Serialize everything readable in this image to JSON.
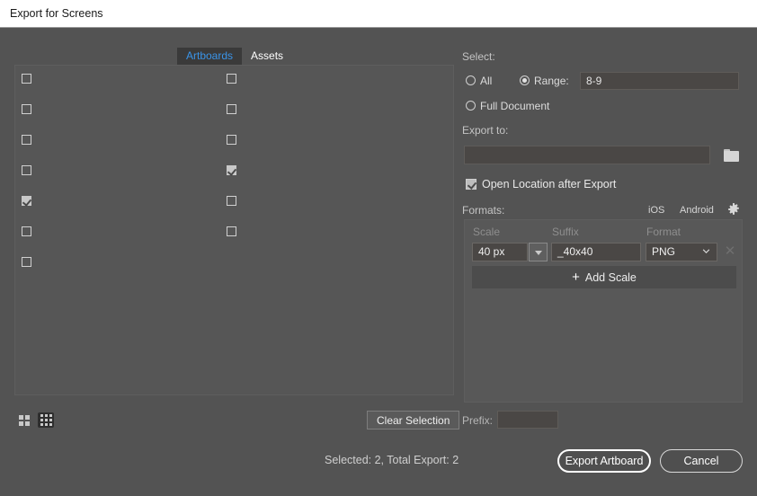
{
  "window": {
    "title": "Export for Screens"
  },
  "tabs": [
    {
      "label": "Artboards",
      "active": true
    },
    {
      "label": "Assets",
      "active": false
    }
  ],
  "artboard_list": {
    "left_column": [
      {
        "checked": false
      },
      {
        "checked": false
      },
      {
        "checked": false
      },
      {
        "checked": false
      },
      {
        "checked": true
      },
      {
        "checked": false
      },
      {
        "checked": false
      }
    ],
    "right_column": [
      {
        "checked": false
      },
      {
        "checked": false
      },
      {
        "checked": false
      },
      {
        "checked": true
      },
      {
        "checked": false
      },
      {
        "checked": false
      }
    ]
  },
  "view_toggles": [
    {
      "icon": "grid-view-icon",
      "selected": false
    },
    {
      "icon": "detail-view-icon",
      "selected": true
    }
  ],
  "left_footer": {
    "clear_selection_label": "Clear Selection"
  },
  "select": {
    "heading": "Select:",
    "options": [
      {
        "label": "All",
        "selected": false
      },
      {
        "label": "Range:",
        "selected": true
      },
      {
        "label": "Full Document",
        "selected": false
      }
    ],
    "range_value": "8-9"
  },
  "export_to": {
    "heading": "Export to:",
    "path_value": "",
    "path_placeholder": "",
    "folder_icon": "folder-icon"
  },
  "open_location": {
    "label": "Open Location after Export",
    "checked": true
  },
  "formats": {
    "heading": "Formats:",
    "presets": [
      {
        "label": "iOS"
      },
      {
        "label": "Android"
      }
    ],
    "settings_icon": "gear-icon",
    "columns": {
      "scale": "Scale",
      "suffix": "Suffix",
      "format": "Format"
    },
    "rows": [
      {
        "scale": "40 px",
        "suffix": "_40x40",
        "format": "PNG",
        "delete_icon": "close-icon"
      }
    ],
    "add_scale_label": "Add Scale",
    "add_scale_icon": "plus-icon"
  },
  "prefix": {
    "label": "Prefix:",
    "value": "",
    "placeholder": ""
  },
  "status": {
    "text": "Selected: 2, Total Export: 2"
  },
  "actions": {
    "export_label": "Export Artboard",
    "cancel_label": "Cancel"
  },
  "colors": {
    "background": "#535353",
    "titlebar": "#ffffff",
    "accent_tab": "#3a94e8",
    "field": "#4a4745"
  }
}
